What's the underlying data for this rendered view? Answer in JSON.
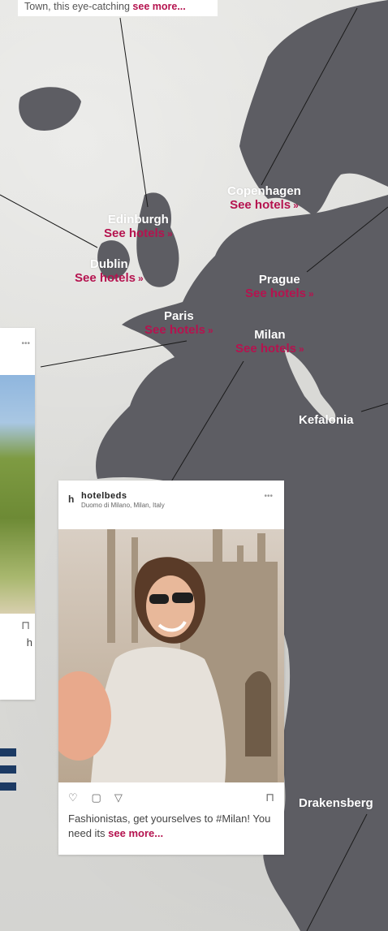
{
  "top_caption": {
    "text": "Town, this eye-catching",
    "more": "see more..."
  },
  "cities": [
    {
      "key": "copenhagen",
      "name": "Copenhagen",
      "link": "See hotels"
    },
    {
      "key": "edinburgh",
      "name": "Edinburgh",
      "link": "See hotels"
    },
    {
      "key": "dublin",
      "name": "Dublin",
      "link": "See hotels"
    },
    {
      "key": "prague",
      "name": "Prague",
      "link": "See hotels"
    },
    {
      "key": "paris",
      "name": "Paris",
      "link": "See hotels"
    },
    {
      "key": "milan",
      "name": "Milan",
      "link": "See hotels"
    },
    {
      "key": "kefalonia",
      "name": "Kefalonia",
      "link": ""
    },
    {
      "key": "drakensberg",
      "name": "Drakensberg",
      "link": ""
    }
  ],
  "link_arrow": "»",
  "milan_post": {
    "user": "hotelbeds",
    "location": "Duomo di Milano, Milan, Italy",
    "caption": "Fashionistas, get yourselves to #Milan! You need its",
    "more": "see more..."
  },
  "left_post": {
    "fragment": "h"
  },
  "colors": {
    "accent": "#b5134f",
    "map": "#5d5d63",
    "navy": "#1c3a63"
  }
}
